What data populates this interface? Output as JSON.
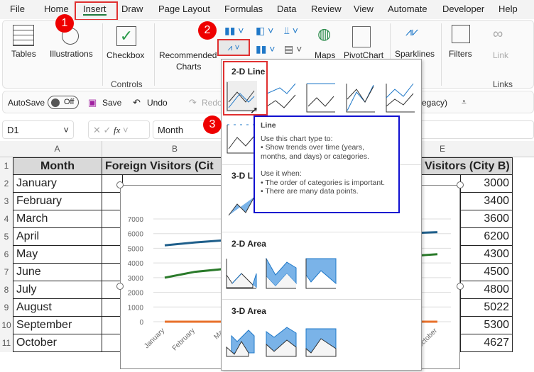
{
  "menu_tabs": [
    "File",
    "Home",
    "Insert",
    "Draw",
    "Page Layout",
    "Formulas",
    "Data",
    "Review",
    "View",
    "Automate",
    "Developer",
    "Help"
  ],
  "ribbon": {
    "tables": "Tables",
    "illustrations": "Illustrations",
    "checkbox": "Checkbox",
    "controls": "Controls",
    "recommended": "Recommended",
    "charts": "Charts",
    "maps": "Maps",
    "pivotchart": "PivotChart",
    "sparklines": "Sparklines",
    "filters": "Filters",
    "link": "Link",
    "links": "Links"
  },
  "qat": {
    "autosave": "AutoSave",
    "off": "Off",
    "save": "Save",
    "undo": "Undo",
    "redo": "Redo",
    "legacy": "egacy)"
  },
  "formula": {
    "namebox": "D1",
    "fx": "fx",
    "value": "Month"
  },
  "columns": [
    "A",
    "B",
    "E"
  ],
  "rows": [
    "1",
    "2",
    "3",
    "4",
    "5",
    "6",
    "7",
    "8",
    "9",
    "10",
    "11"
  ],
  "table": {
    "h_month": "Month",
    "h_b": "Foreign Visitors (Cit",
    "h_e": "Visitors (City B)",
    "months": [
      "January",
      "February",
      "March",
      "April",
      "May",
      "June",
      "July",
      "August",
      "September",
      "October"
    ],
    "city_b": [
      "3000",
      "3400",
      "3600",
      "6200",
      "4300",
      "4500",
      "4800",
      "5022",
      "5300",
      "4627"
    ]
  },
  "steps": [
    "1",
    "2",
    "3"
  ],
  "dropdown": {
    "line2d": "2-D Line",
    "line3d": "3-D L",
    "area2d": "2-D Area",
    "area3d": "3-D Area"
  },
  "tooltip": {
    "title": "Line",
    "use_to": "Use this chart type to:",
    "b1": "• Show trends over time (years, months, and days) or categories.",
    "use_when": "Use it when:",
    "b2": "• The order of categories is important.",
    "b3": "• There are many data points."
  },
  "chart_data": {
    "type": "line",
    "yticks": [
      "7000",
      "6000",
      "5000",
      "4000",
      "3000",
      "2000",
      "1000",
      "0"
    ],
    "ylim": [
      0,
      7000
    ],
    "xlabels": [
      "January",
      "February",
      "Mar",
      "October"
    ],
    "series": [
      {
        "name": "blue",
        "color": "#1f5f8b",
        "points": [
          [
            0,
            5200
          ],
          [
            1,
            5400
          ],
          [
            2,
            5550
          ],
          [
            9,
            6100
          ]
        ]
      },
      {
        "name": "green",
        "color": "#2a7a2a",
        "points": [
          [
            0,
            3000
          ],
          [
            1,
            3400
          ],
          [
            2,
            3600
          ],
          [
            9,
            4600
          ]
        ]
      },
      {
        "name": "orange",
        "color": "#e8702a",
        "points": [
          [
            0,
            0
          ],
          [
            9,
            0
          ]
        ]
      }
    ]
  }
}
